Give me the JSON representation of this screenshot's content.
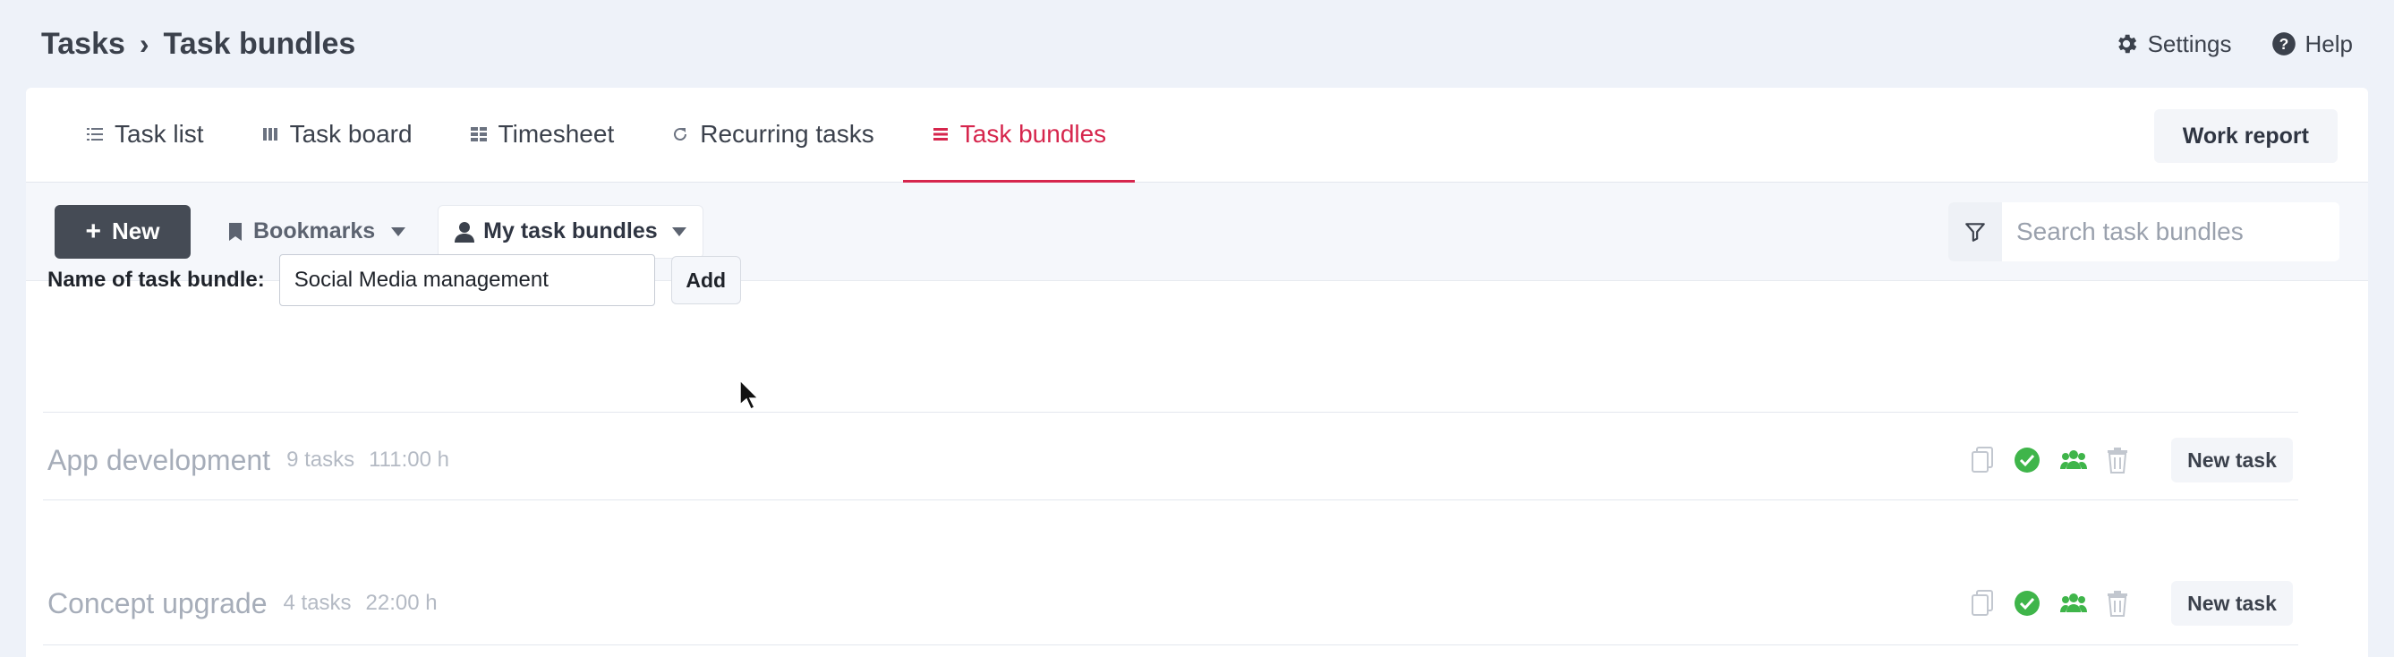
{
  "breadcrumb": {
    "root": "Tasks",
    "separator": "›",
    "current": "Task bundles"
  },
  "header": {
    "settings_label": "Settings",
    "help_label": "Help"
  },
  "tabs": [
    {
      "label": "Task list",
      "icon": "list-icon"
    },
    {
      "label": "Task board",
      "icon": "board-icon"
    },
    {
      "label": "Timesheet",
      "icon": "grid-icon"
    },
    {
      "label": "Recurring tasks",
      "icon": "refresh-icon"
    },
    {
      "label": "Task bundles",
      "icon": "stack-icon",
      "active": true
    }
  ],
  "work_report_label": "Work report",
  "toolbar": {
    "new_label": "New",
    "bookmarks_label": "Bookmarks",
    "my_bundles_label": "My task bundles",
    "search_placeholder": "Search task bundles"
  },
  "form": {
    "label": "Name of task bundle:",
    "value": "Social Media management",
    "add_label": "Add"
  },
  "bundles": [
    {
      "name": "App development",
      "tasks": "9 tasks",
      "hours": "111:00 h",
      "new_task_label": "New task"
    },
    {
      "name": "Concept upgrade",
      "tasks": "4 tasks",
      "hours": "22:00 h",
      "new_task_label": "New task"
    }
  ],
  "colors": {
    "accent": "#d6264d",
    "success": "#3fb54a",
    "dark_button": "#454b55"
  }
}
